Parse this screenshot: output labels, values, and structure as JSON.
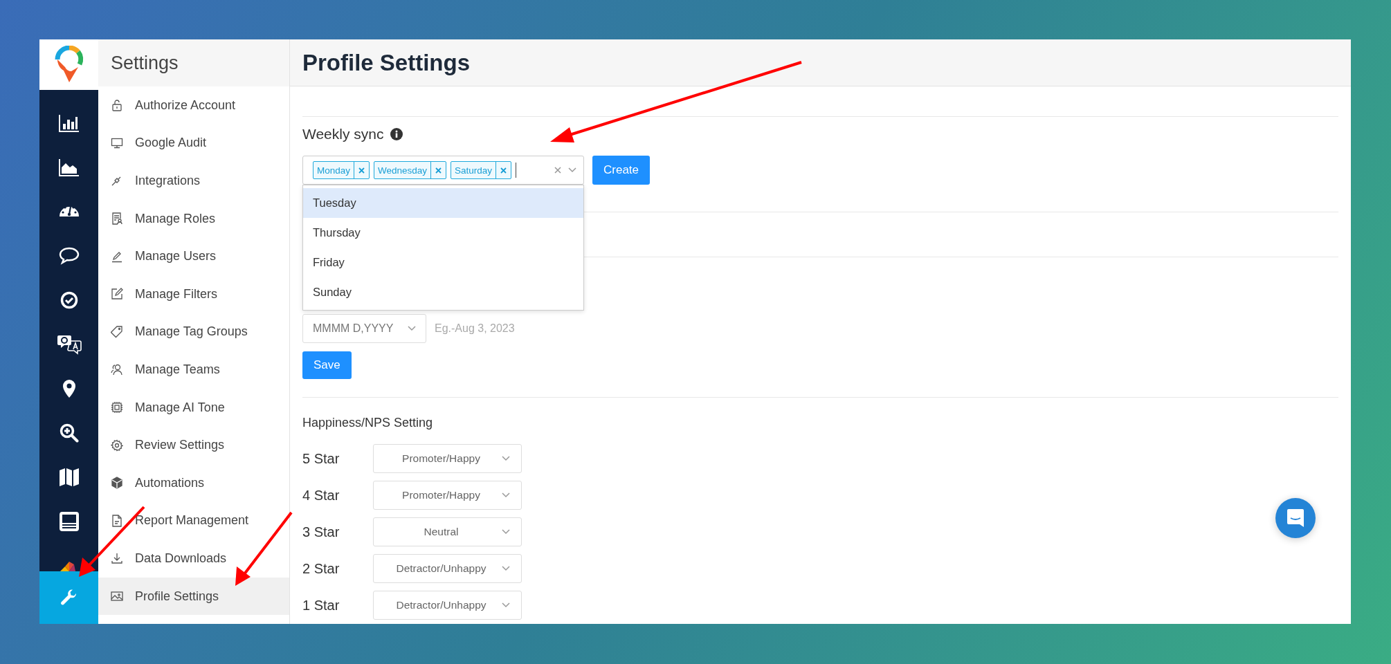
{
  "rail": [
    {
      "kind": "bar-chart",
      "selected": false
    },
    {
      "kind": "area-chart",
      "selected": false
    },
    {
      "kind": "gauge",
      "selected": false
    },
    {
      "kind": "speech",
      "selected": false
    },
    {
      "kind": "check-circle",
      "selected": false
    },
    {
      "kind": "qa",
      "selected": false
    },
    {
      "kind": "pin",
      "selected": false
    },
    {
      "kind": "zoom",
      "selected": false
    },
    {
      "kind": "map",
      "selected": false
    },
    {
      "kind": "monitor",
      "selected": false
    },
    {
      "kind": "pinwheel",
      "selected": false
    },
    {
      "kind": "wrench",
      "selected": true
    }
  ],
  "sidebar": {
    "title": "Settings",
    "items": [
      {
        "label": "Authorize Account",
        "kind": "lock",
        "selected": false
      },
      {
        "label": "Google Audit",
        "kind": "monitor",
        "selected": false
      },
      {
        "label": "Integrations",
        "kind": "plug",
        "selected": false
      },
      {
        "label": "Manage Roles",
        "kind": "doc-user",
        "selected": false
      },
      {
        "label": "Manage Users",
        "kind": "pencil",
        "selected": false
      },
      {
        "label": "Manage Filters",
        "kind": "edit",
        "selected": false
      },
      {
        "label": "Manage Tag Groups",
        "kind": "tag",
        "selected": false
      },
      {
        "label": "Manage Teams",
        "kind": "users",
        "selected": false
      },
      {
        "label": "Manage AI Tone",
        "kind": "chip",
        "selected": false
      },
      {
        "label": "Review Settings",
        "kind": "gear",
        "selected": false
      },
      {
        "label": "Automations",
        "kind": "cube",
        "selected": false
      },
      {
        "label": "Report Management",
        "kind": "file",
        "selected": false
      },
      {
        "label": "Data Downloads",
        "kind": "download",
        "selected": false
      },
      {
        "label": "Profile Settings",
        "kind": "image",
        "selected": true
      }
    ]
  },
  "page": {
    "title": "Profile Settings"
  },
  "weekly_sync": {
    "label": "Weekly sync",
    "tags": [
      "Monday",
      "Wednesday",
      "Saturday"
    ],
    "options": [
      {
        "label": "Tuesday",
        "highlighted": true
      },
      {
        "label": "Thursday",
        "highlighted": false
      },
      {
        "label": "Friday",
        "highlighted": false
      },
      {
        "label": "Sunday",
        "highlighted": false
      }
    ],
    "button": "Create"
  },
  "date_format": {
    "value": "MMMM D,YYYY",
    "example": "Eg.-Aug 3, 2023",
    "button": "Save"
  },
  "nps": {
    "title": "Happiness/NPS Setting",
    "rows": [
      {
        "label": "5 Star",
        "value": "Promoter/Happy"
      },
      {
        "label": "4 Star",
        "value": "Promoter/Happy"
      },
      {
        "label": "3 Star",
        "value": "Neutral"
      },
      {
        "label": "2 Star",
        "value": "Detractor/Unhappy"
      },
      {
        "label": "1 Star",
        "value": "Detractor/Unhappy"
      }
    ]
  }
}
